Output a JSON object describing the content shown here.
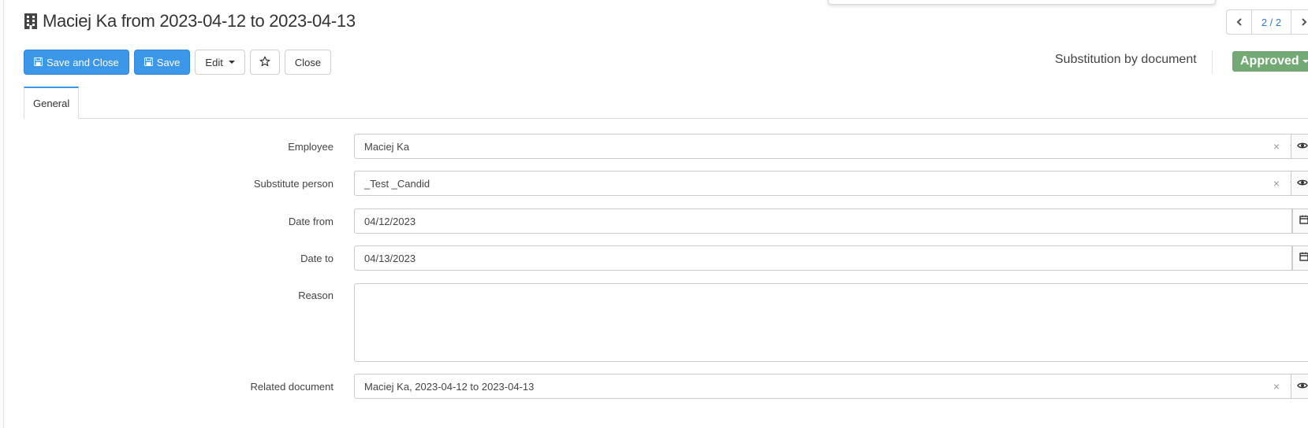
{
  "header": {
    "title": "Maciej Ka from 2023-04-12 to 2023-04-13",
    "title_icon": "building-icon",
    "pager": {
      "count": "2 / 2"
    }
  },
  "toolbar": {
    "save_close_label": "Save and Close",
    "save_label": "Save",
    "edit_label": "Edit",
    "close_label": "Close"
  },
  "doc_type": "Substitution by document",
  "status": {
    "label": "Approved",
    "color": "#72a974"
  },
  "tabs": [
    {
      "label": "General",
      "active": true
    }
  ],
  "form": {
    "employee": {
      "label": "Employee",
      "value": "Maciej Ka"
    },
    "substitute": {
      "label": "Substitute person",
      "value": "_Test _Candid"
    },
    "date_from": {
      "label": "Date from",
      "value": "04/12/2023"
    },
    "date_to": {
      "label": "Date to",
      "value": "04/13/2023"
    },
    "reason": {
      "label": "Reason",
      "value": ""
    },
    "related": {
      "label": "Related document",
      "value": "Maciej Ka, 2023-04-12 to 2023-04-13"
    }
  },
  "colors": {
    "primary": "#3c97e8",
    "status_approved": "#72a974",
    "link": "#2b7bd6"
  }
}
